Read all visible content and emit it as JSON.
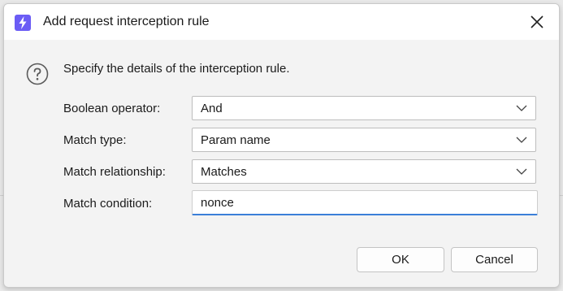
{
  "window": {
    "title": "Add request interception rule",
    "app_icon": "lightning-icon",
    "close_icon": "close-icon"
  },
  "intro": {
    "icon": "help-icon",
    "text": "Specify the details of the interception rule."
  },
  "form": {
    "boolean_operator": {
      "label": "Boolean operator:",
      "value": "And"
    },
    "match_type": {
      "label": "Match type:",
      "value": "Param name"
    },
    "match_relationship": {
      "label": "Match relationship:",
      "value": "Matches"
    },
    "match_condition": {
      "label": "Match condition:",
      "value": "nonce"
    }
  },
  "buttons": {
    "ok": "OK",
    "cancel": "Cancel"
  },
  "colors": {
    "accent": "#6b5cf5",
    "focus": "#3b7fd8"
  }
}
